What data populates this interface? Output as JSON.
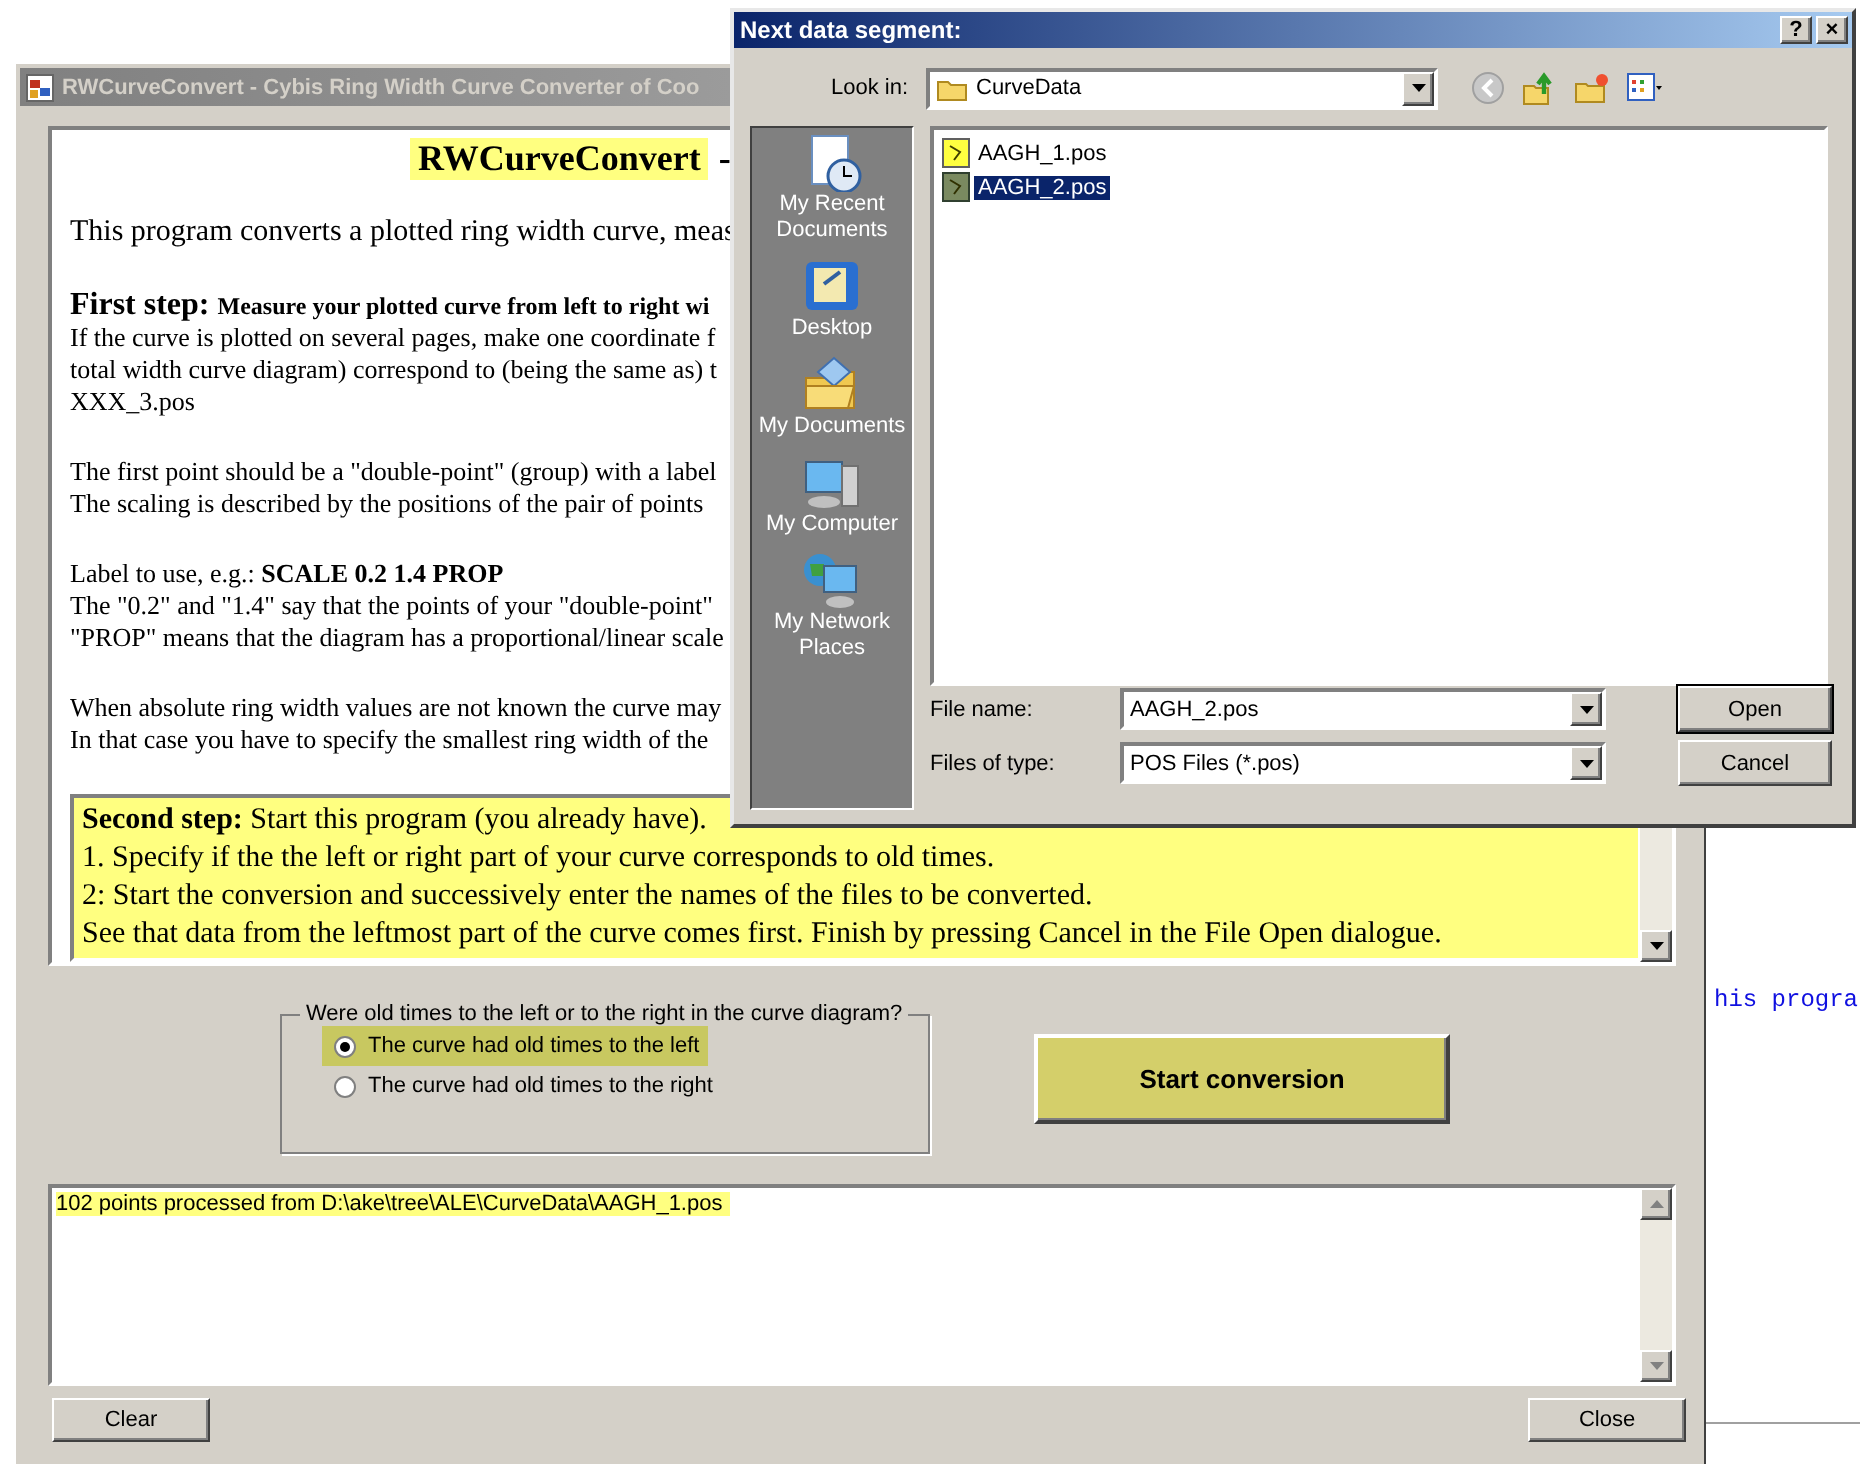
{
  "background": {
    "text": "his progra"
  },
  "main_window": {
    "title": "RWCurveConvert - Cybis Ring Width Curve Converter of Coo",
    "help": {
      "heading": "RWCurveConvert",
      "heading_rest": "-",
      "paragraphs": [
        {
          "kind": "lead",
          "lines": [
            "This program converts a plotted ring width curve, meas"
          ]
        },
        {
          "kind": "step",
          "label": "First step:",
          "lines": [
            "Measure your plotted curve from left to right wi",
            "If the curve is plotted on several pages, make one coordinate f",
            "total width curve diagram) correspond to (being the same as) t",
            "XXX_3.pos"
          ]
        },
        {
          "kind": "plain",
          "lines": [
            "The first point should be a \"double-point\" (group) with a label",
            "The scaling is described by the positions of the pair of points"
          ]
        },
        {
          "kind": "plain",
          "lines": [
            "Label to use, e.g.: **SCALE 0.2 1.4 PROP**",
            "The \"0.2\" and \"1.4\" say that the points of your \"double-point\"",
            "\"PROP\" means that the diagram has a proportional/linear scale"
          ]
        },
        {
          "kind": "plain",
          "lines": [
            "When absolute ring width values are not known the curve may",
            "In that case you have to specify the smallest ring width of the"
          ]
        }
      ],
      "note": {
        "label": "Second step:",
        "lines": [
          "Start this program (you already have).",
          "1. Specify if the the left or right part of your curve corresponds to old times.",
          "2: Start the conversion and successively enter the names of the files to be converted.",
          "See that data from the leftmost part of the curve comes first. Finish by pressing Cancel in the File Open dialogue."
        ]
      }
    },
    "direction_group": {
      "legend": "Were old times to the left or to the right in the curve diagram?",
      "options": [
        {
          "label": "The curve had old times to the left",
          "selected": true
        },
        {
          "label": "The curve had old times to the right",
          "selected": false
        }
      ]
    },
    "start_button": "Start conversion",
    "log": {
      "lines": [
        "102 points processed from D:\\ake\\tree\\ALE\\CurveData\\AAGH_1.pos"
      ]
    },
    "buttons": [
      {
        "label": "Clear"
      },
      {
        "label": "Close"
      }
    ]
  },
  "dialog": {
    "title": "Next data segment:",
    "help_button": "?",
    "close_button": "×",
    "look_in": {
      "label": "Look in:",
      "value": "CurveData"
    },
    "places": [
      {
        "label": "My Recent Documents",
        "kind": "recent"
      },
      {
        "label": "Desktop",
        "kind": "desktop"
      },
      {
        "label": "My Documents",
        "kind": "documents"
      },
      {
        "label": "My Computer",
        "kind": "computer"
      },
      {
        "label": "My Network Places",
        "kind": "network"
      }
    ],
    "files": [
      {
        "name": "AAGH_1.pos",
        "selected": false
      },
      {
        "name": "AAGH_2.pos",
        "selected": true
      }
    ],
    "file_name": {
      "label": "File name:",
      "value": "AAGH_2.pos"
    },
    "file_type": {
      "label": "Files of type:",
      "value": "POS Files (*.pos)"
    },
    "buttons": [
      {
        "label": "Open",
        "kind": "default"
      },
      {
        "label": "Cancel",
        "kind": "normal"
      }
    ]
  }
}
